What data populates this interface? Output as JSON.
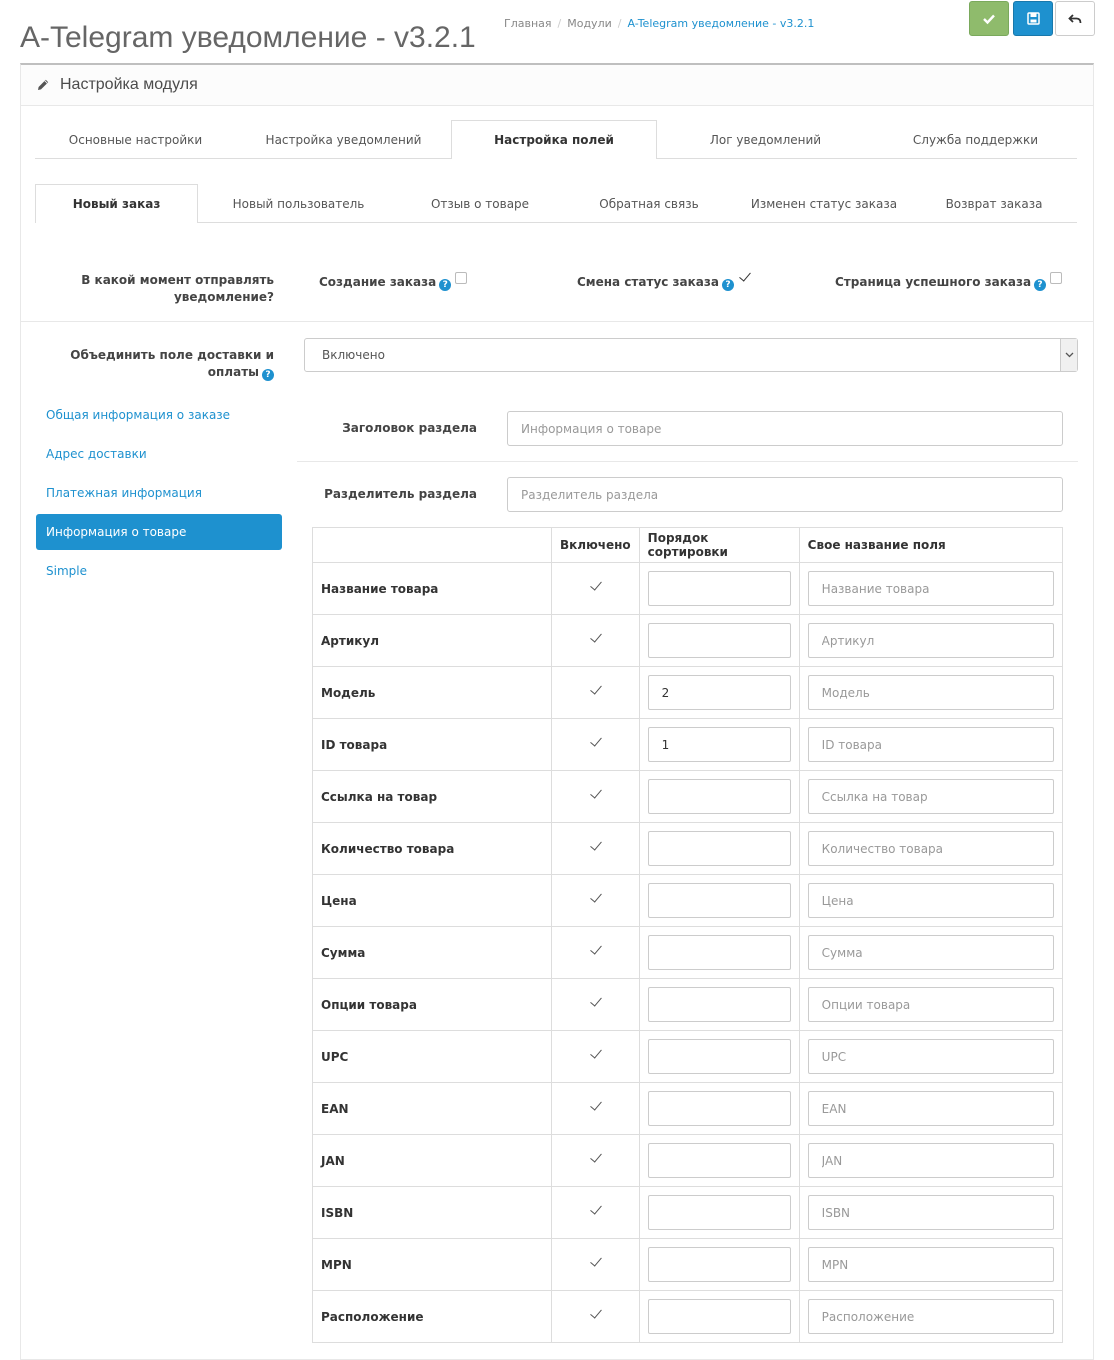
{
  "header": {
    "title": "A-Telegram уведомление - v3.2.1",
    "breadcrumb": [
      "Главная",
      "Модули",
      "A-Telegram уведомление - v3.2.1"
    ]
  },
  "panel": {
    "title": "Настройка модуля"
  },
  "main_tabs": [
    {
      "label": "Основные настройки",
      "active": false
    },
    {
      "label": "Настройка уведомлений",
      "active": false
    },
    {
      "label": "Настройка полей",
      "active": true
    },
    {
      "label": "Лог уведомлений",
      "active": false
    },
    {
      "label": "Служба поддержки",
      "active": false
    }
  ],
  "sub_tabs": [
    {
      "label": "Новый заказ",
      "active": true
    },
    {
      "label": "Новый пользователь",
      "active": false
    },
    {
      "label": "Отзыв о товаре",
      "active": false
    },
    {
      "label": "Обратная связь",
      "active": false
    },
    {
      "label": "Изменен статус заказа",
      "active": false
    },
    {
      "label": "Возврат заказа",
      "active": false
    }
  ],
  "send_moment": {
    "label": "В какой момент отправлять уведомление?",
    "options": [
      {
        "label": "Создание заказа",
        "checked": false
      },
      {
        "label": "Смена статус заказа",
        "checked": true
      },
      {
        "label": "Страница успешного заказа",
        "checked": false
      }
    ]
  },
  "merge_fields": {
    "label": "Объединить поле доставки и оплаты",
    "value": "Включено"
  },
  "side_nav": [
    {
      "label": "Общая информация о заказе",
      "active": false
    },
    {
      "label": "Адрес доставки",
      "active": false
    },
    {
      "label": "Платежная информация",
      "active": false
    },
    {
      "label": "Информация о товаре",
      "active": true
    },
    {
      "label": "Simple",
      "active": false
    }
  ],
  "section": {
    "title_label": "Заголовок раздела",
    "title_placeholder": "Информация о товаре",
    "separator_label": "Разделитель раздела",
    "separator_placeholder": "Разделитель раздела"
  },
  "fields_table": {
    "columns": [
      "",
      "Включено",
      "Порядок сортировки",
      "Свое название поля"
    ],
    "rows": [
      {
        "name": "Название товара",
        "enabled": true,
        "sort": "",
        "placeholder": "Название товара"
      },
      {
        "name": "Артикул",
        "enabled": true,
        "sort": "",
        "placeholder": "Артикул"
      },
      {
        "name": "Модель",
        "enabled": true,
        "sort": "2",
        "placeholder": "Модель"
      },
      {
        "name": "ID товара",
        "enabled": true,
        "sort": "1",
        "placeholder": "ID товара"
      },
      {
        "name": "Ссылка на товар",
        "enabled": true,
        "sort": "",
        "placeholder": "Ссылка на товар"
      },
      {
        "name": "Количество товара",
        "enabled": true,
        "sort": "",
        "placeholder": "Количество товара"
      },
      {
        "name": "Цена",
        "enabled": true,
        "sort": "",
        "placeholder": "Цена"
      },
      {
        "name": "Сумма",
        "enabled": true,
        "sort": "",
        "placeholder": "Сумма"
      },
      {
        "name": "Опции товара",
        "enabled": true,
        "sort": "",
        "placeholder": "Опции товара"
      },
      {
        "name": "UPC",
        "enabled": true,
        "sort": "",
        "placeholder": "UPC"
      },
      {
        "name": "EAN",
        "enabled": true,
        "sort": "",
        "placeholder": "EAN"
      },
      {
        "name": "JAN",
        "enabled": true,
        "sort": "",
        "placeholder": "JAN"
      },
      {
        "name": "ISBN",
        "enabled": true,
        "sort": "",
        "placeholder": "ISBN"
      },
      {
        "name": "MPN",
        "enabled": true,
        "sort": "",
        "placeholder": "MPN"
      },
      {
        "name": "Расположение",
        "enabled": true,
        "sort": "",
        "placeholder": "Расположение"
      }
    ]
  },
  "icons": {
    "save_green": "check-icon",
    "save_blue": "floppy-disk-icon",
    "back": "reply-arrow-icon",
    "panel": "pencil-icon",
    "help": "question-circle-icon"
  },
  "colors": {
    "primary": "#1e91cf",
    "success": "#8fbb6c"
  }
}
